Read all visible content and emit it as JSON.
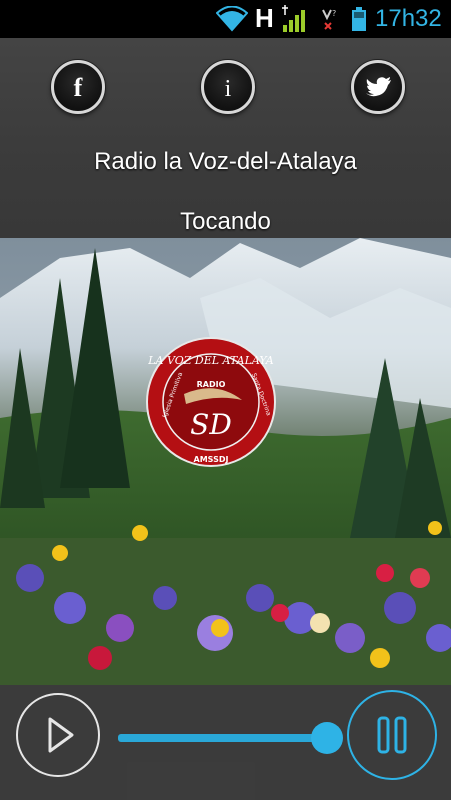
{
  "status_bar": {
    "network_type": "H",
    "time": "17h32",
    "icons": [
      "wifi-icon",
      "signal-icon",
      "no-sim-icon",
      "battery-icon"
    ],
    "accent_color": "#33b5e5"
  },
  "social": {
    "facebook_icon": "facebook-icon",
    "facebook_label": "f",
    "info_icon": "info-icon",
    "info_label": "i",
    "twitter_icon": "twitter-bird-icon"
  },
  "station": {
    "name": "Radio la Voz-del-Atalaya",
    "status": "Tocando"
  },
  "logo": {
    "top_text": "LA VOZ DEL ATALAYA",
    "sub_text": "RADIO",
    "center_text": "SD",
    "ring_left": "Iglesia Primitiva",
    "ring_right": "Santa Doctrina",
    "ring_bottom": "AMSSDJ"
  },
  "player": {
    "play_icon": "play-icon",
    "pause_icon": "pause-icon",
    "volume_level": 1.0,
    "accent_color": "#2eb3e6"
  }
}
